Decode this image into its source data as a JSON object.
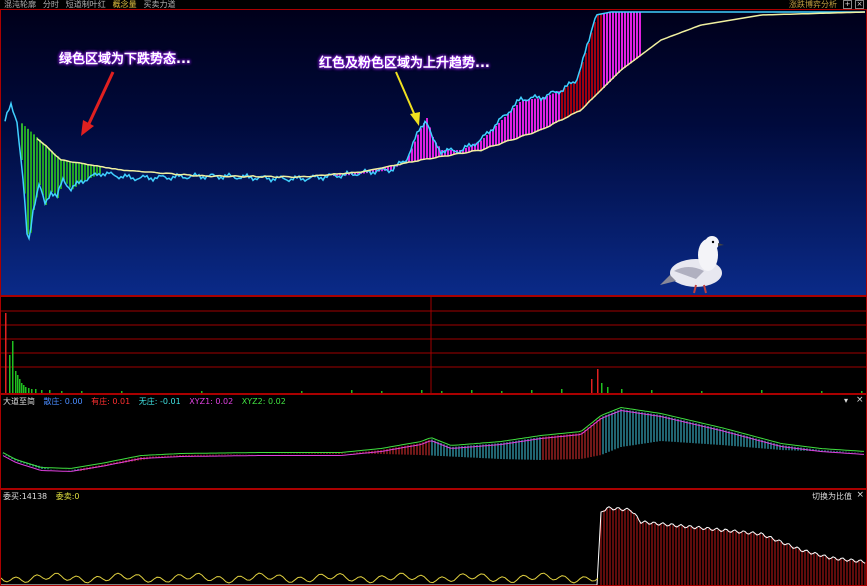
{
  "topbar": {
    "items": [
      "混沌轮廓",
      "分时",
      "短道制叶红",
      "概念量",
      "买卖力道"
    ],
    "right_label": "涨跌博弈分析"
  },
  "pane1": {
    "annotation_left": "绿色区域为下跌势态...",
    "annotation_right": "红色及粉色区域为上升趋势..."
  },
  "pane3": {
    "name": "大道至简",
    "legend": [
      {
        "label": "散庄: 0.00",
        "color": "#4a8cff"
      },
      {
        "label": "有庄: 0.01",
        "color": "#ff3030"
      },
      {
        "label": "无庄: -0.01",
        "color": "#40e0e0"
      },
      {
        "label": "XYZ1: 0.02",
        "color": "#e040e0"
      },
      {
        "label": "XYZ2: 0.02",
        "color": "#40e040"
      }
    ]
  },
  "pane4": {
    "buy_label": "委买:14138",
    "sell_label": "委卖:0",
    "switch_label": "切换为比值"
  },
  "colors": {
    "frame": "#aa0000",
    "green": "#20a020",
    "magenta": "#e020e0",
    "darkred": "#a00010",
    "cyan": "#40d0ff"
  },
  "icons": [
    "pigeon-icon",
    "arrow-icon",
    "close-icon",
    "dropdown-icon"
  ]
}
